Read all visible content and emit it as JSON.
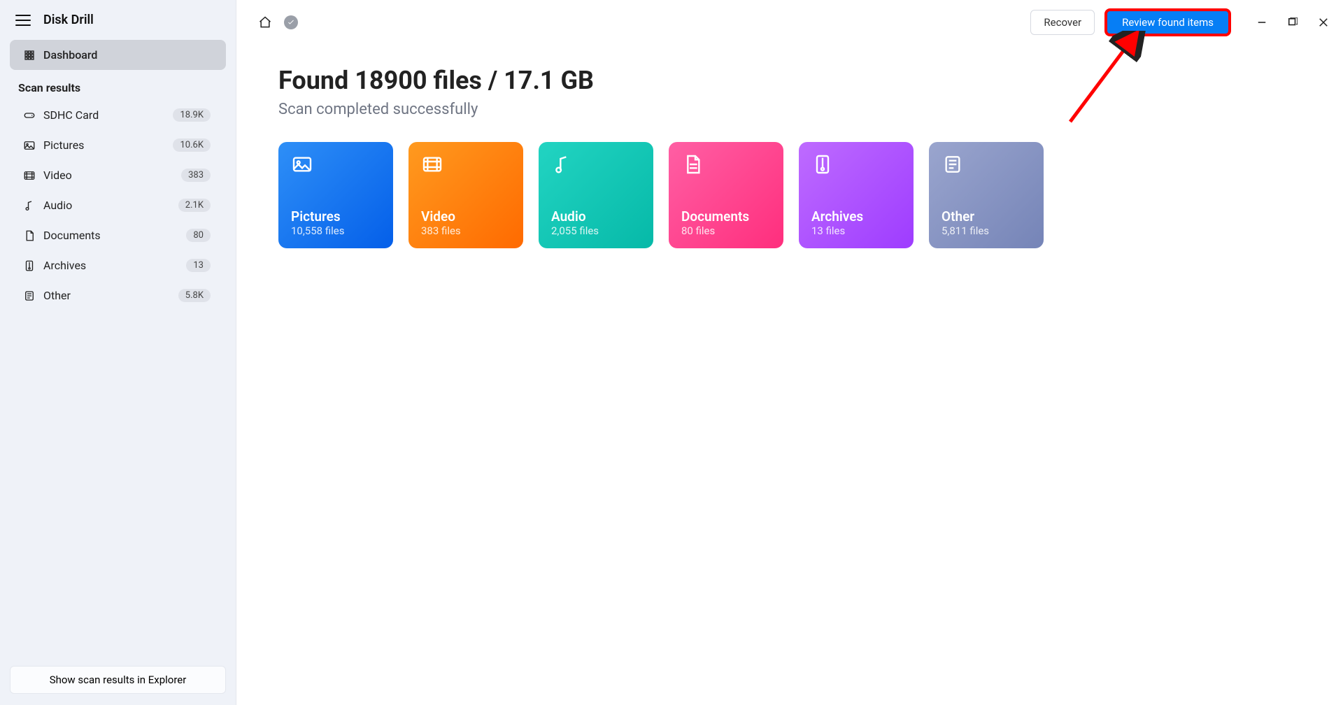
{
  "app": {
    "title": "Disk Drill"
  },
  "sidebar": {
    "dashboard_label": "Dashboard",
    "section_label": "Scan results",
    "items": [
      {
        "label": "SDHC Card",
        "count": "18.9K"
      },
      {
        "label": "Pictures",
        "count": "10.6K"
      },
      {
        "label": "Video",
        "count": "383"
      },
      {
        "label": "Audio",
        "count": "2.1K"
      },
      {
        "label": "Documents",
        "count": "80"
      },
      {
        "label": "Archives",
        "count": "13"
      },
      {
        "label": "Other",
        "count": "5.8K"
      }
    ],
    "explorer_button": "Show scan results in Explorer"
  },
  "topbar": {
    "recover_label": "Recover",
    "review_label": "Review found items"
  },
  "results": {
    "headline": "Found 18900 files / 17.1 GB",
    "subhead": "Scan completed successfully",
    "categories": [
      {
        "title": "Pictures",
        "sub": "10,558 files"
      },
      {
        "title": "Video",
        "sub": "383 files"
      },
      {
        "title": "Audio",
        "sub": "2,055 files"
      },
      {
        "title": "Documents",
        "sub": "80 files"
      },
      {
        "title": "Archives",
        "sub": "13 files"
      },
      {
        "title": "Other",
        "sub": "5,811 files"
      }
    ]
  }
}
